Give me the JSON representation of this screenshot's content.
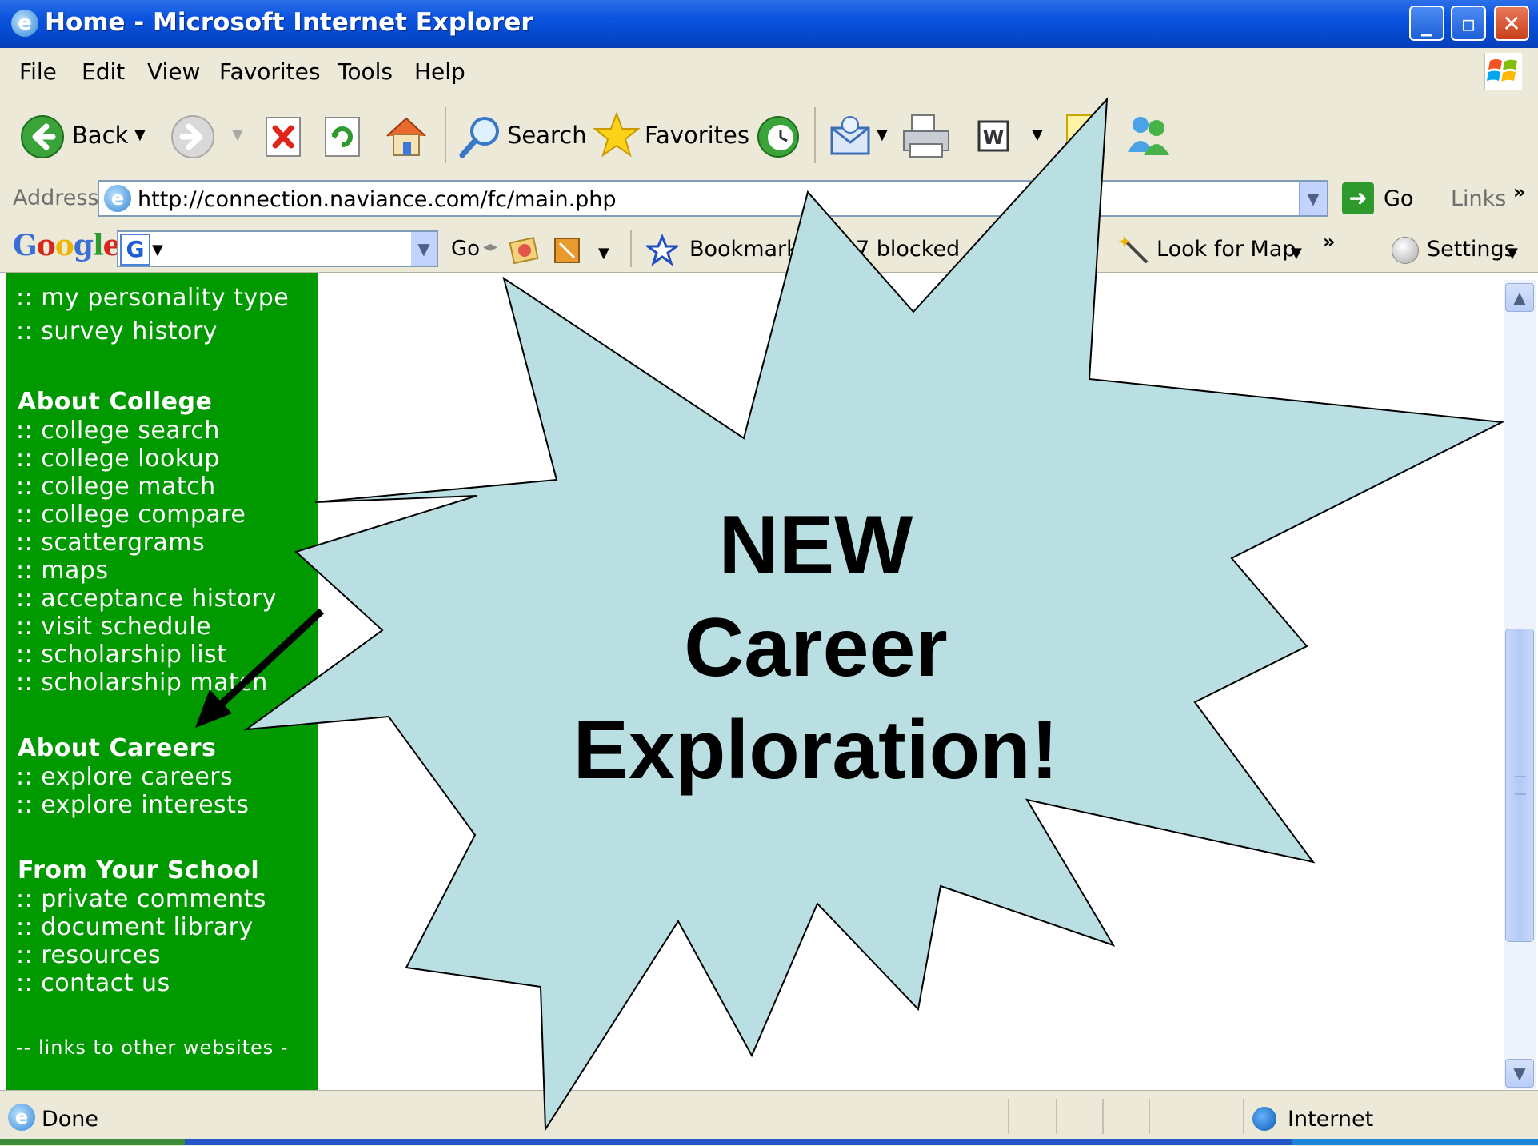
{
  "window": {
    "title": "Home - Microsoft Internet Explorer",
    "minimize": "_",
    "maximize": "▫",
    "close": "✕"
  },
  "menu": [
    "File",
    "Edit",
    "View",
    "Favorites",
    "Tools",
    "Help"
  ],
  "toolbar": {
    "back": "Back",
    "search": "Search",
    "favorites": "Favorites"
  },
  "address": {
    "label": "Address",
    "url": "http://connection.naviance.com/fc/main.php",
    "go": "Go",
    "links": "Links"
  },
  "google_toolbar": {
    "logo": "Google",
    "go": "Go",
    "bookmarks": "Bookmarks",
    "blocked": "7 blocked",
    "look_for_map": "Look for Map",
    "settings": "Settings"
  },
  "sidebar": {
    "top_links": [
      ":: my personality type",
      ":: survey history"
    ],
    "sections": [
      {
        "heading": "About College",
        "links": [
          ":: college search",
          ":: college lookup",
          ":: college match",
          ":: college compare",
          ":: scattergrams",
          ":: maps",
          ":: acceptance history",
          ":: visit schedule",
          ":: scholarship list",
          ":: scholarship match"
        ]
      },
      {
        "heading": "About Careers",
        "links": [
          ":: explore careers",
          ":: explore interests"
        ]
      },
      {
        "heading": "From Your School",
        "links": [
          ":: private comments",
          ":: document library",
          ":: resources",
          ":: contact us"
        ]
      }
    ],
    "footer": "-- links to other websites -"
  },
  "callout": {
    "lines": [
      "NEW",
      "Career",
      "Exploration!"
    ],
    "fill_color": "#b9dfe3"
  },
  "status": {
    "text": "Done",
    "zone": "Internet"
  }
}
